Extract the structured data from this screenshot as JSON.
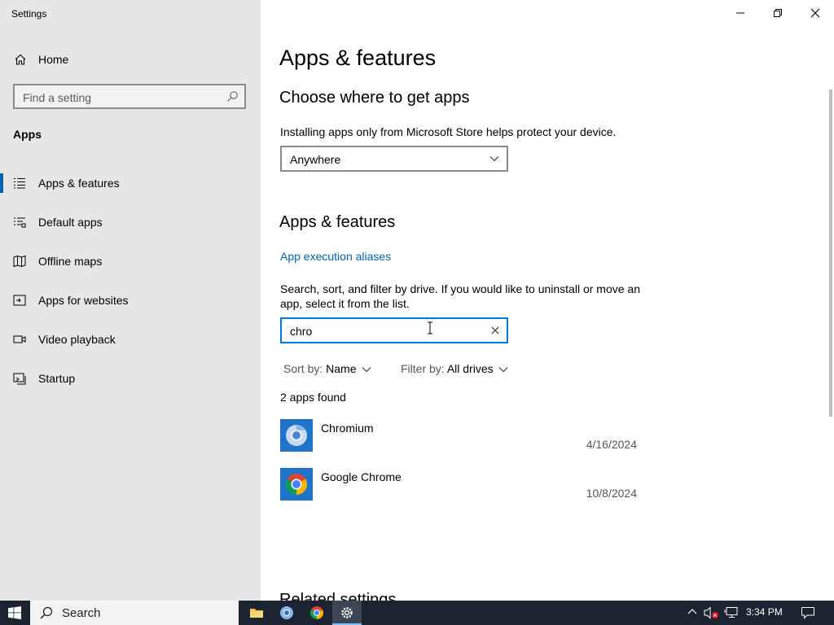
{
  "window": {
    "title": "Settings"
  },
  "sidebar": {
    "home_label": "Home",
    "search_placeholder": "Find a setting",
    "section_title": "Apps",
    "items": [
      {
        "label": "Apps & features",
        "icon": "list-icon",
        "active": true
      },
      {
        "label": "Default apps",
        "icon": "default-apps-icon",
        "active": false
      },
      {
        "label": "Offline maps",
        "icon": "map-icon",
        "active": false
      },
      {
        "label": "Apps for websites",
        "icon": "web-apps-icon",
        "active": false
      },
      {
        "label": "Video playback",
        "icon": "video-icon",
        "active": false
      },
      {
        "label": "Startup",
        "icon": "startup-icon",
        "active": false
      }
    ]
  },
  "main": {
    "page_title": "Apps & features",
    "choose": {
      "heading": "Choose where to get apps",
      "description": "Installing apps only from Microsoft Store helps protect your device.",
      "dropdown_value": "Anywhere"
    },
    "features": {
      "heading": "Apps & features",
      "alias_link": "App execution aliases",
      "description_line1": "Search, sort, and filter by drive. If you would like to uninstall or move an",
      "description_line2": "app, select it from the list.",
      "search_value": "chro",
      "sort_label": "Sort by:",
      "sort_value": "Name",
      "filter_label": "Filter by:",
      "filter_value": "All drives",
      "result_count": "2 apps found",
      "apps": [
        {
          "name": "Chromium",
          "date": "4/16/2024",
          "icon": "chromium-icon"
        },
        {
          "name": "Google Chrome",
          "date": "10/8/2024",
          "icon": "chrome-icon"
        }
      ]
    },
    "related_heading": "Related settings"
  },
  "taskbar": {
    "search_label": "Search",
    "clock": "3:34 PM",
    "apps": [
      "file-explorer-icon",
      "chromium-icon",
      "chrome-icon",
      "settings-icon"
    ]
  },
  "colors": {
    "accent": "#0078d7",
    "link": "#0063b1",
    "sidebar_bg": "#e6e6e6",
    "taskbar_bg": "#1b2430"
  }
}
